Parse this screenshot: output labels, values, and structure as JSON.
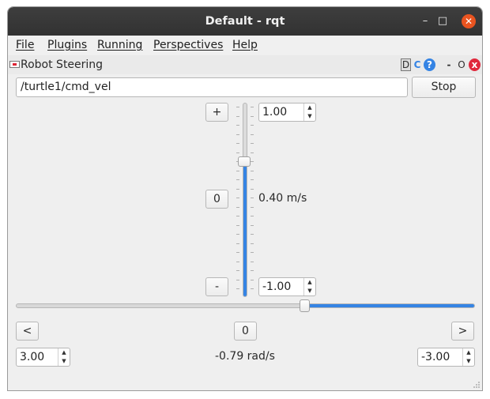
{
  "window": {
    "title": "Default - rqt"
  },
  "titlebar_buttons": {
    "minimize": "–",
    "maximize": "□",
    "close": "✕"
  },
  "menu": [
    "File",
    "Plugins",
    "Running",
    "Perspectives",
    "Help"
  ],
  "plugin": {
    "title": "Robot Steering",
    "controls": {
      "d": "D",
      "reload": "C",
      "help": "?",
      "minimize": "-",
      "float": "O",
      "close": "x"
    }
  },
  "topic": {
    "value": "/turtle1/cmd_vel"
  },
  "stop_label": "Stop",
  "linear": {
    "increase_label": "+",
    "reset_label": "0",
    "decrease_label": "-",
    "max": "1.00",
    "min": "-1.00",
    "value_text": "0.40 m/s",
    "value": 0.4,
    "range": [
      -1.0,
      1.0
    ]
  },
  "angular": {
    "left_label": "<",
    "reset_label": "0",
    "right_label": ">",
    "left_limit": "3.00",
    "right_limit": "-3.00",
    "value_text": "-0.79 rad/s",
    "value": -0.79,
    "range": [
      3.0,
      -3.0
    ]
  },
  "colors": {
    "accent": "#3584e4",
    "close": "#e95420",
    "titlebar": "#383838"
  }
}
